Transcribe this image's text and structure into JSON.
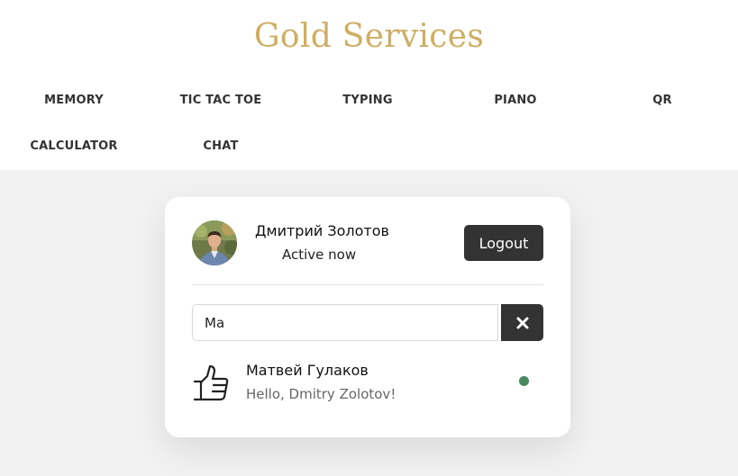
{
  "brand": {
    "title": "Gold Services"
  },
  "nav": {
    "items": [
      {
        "label": "MEMORY"
      },
      {
        "label": "TIC TAC TOE"
      },
      {
        "label": "TYPING"
      },
      {
        "label": "PIANO"
      },
      {
        "label": "QR"
      },
      {
        "label": "CALCULATOR"
      },
      {
        "label": "CHAT"
      }
    ]
  },
  "chat": {
    "current_user": {
      "name": "Дмитрий Золотов",
      "status": "Active now",
      "avatar_icon": "user-photo"
    },
    "logout_label": "Logout",
    "search": {
      "value": "Ma",
      "clear_icon": "close-icon"
    },
    "users": [
      {
        "name": "Матвей Гулаков",
        "last_message": "Hello, Dmitry Zolotov!",
        "avatar_icon": "thumbs-up-icon",
        "online": true,
        "status_color": "#468a62"
      }
    ]
  },
  "colors": {
    "brand": "#cfae62",
    "dark": "#333333",
    "online": "#468a62",
    "page_bg": "#f2f2f2"
  }
}
